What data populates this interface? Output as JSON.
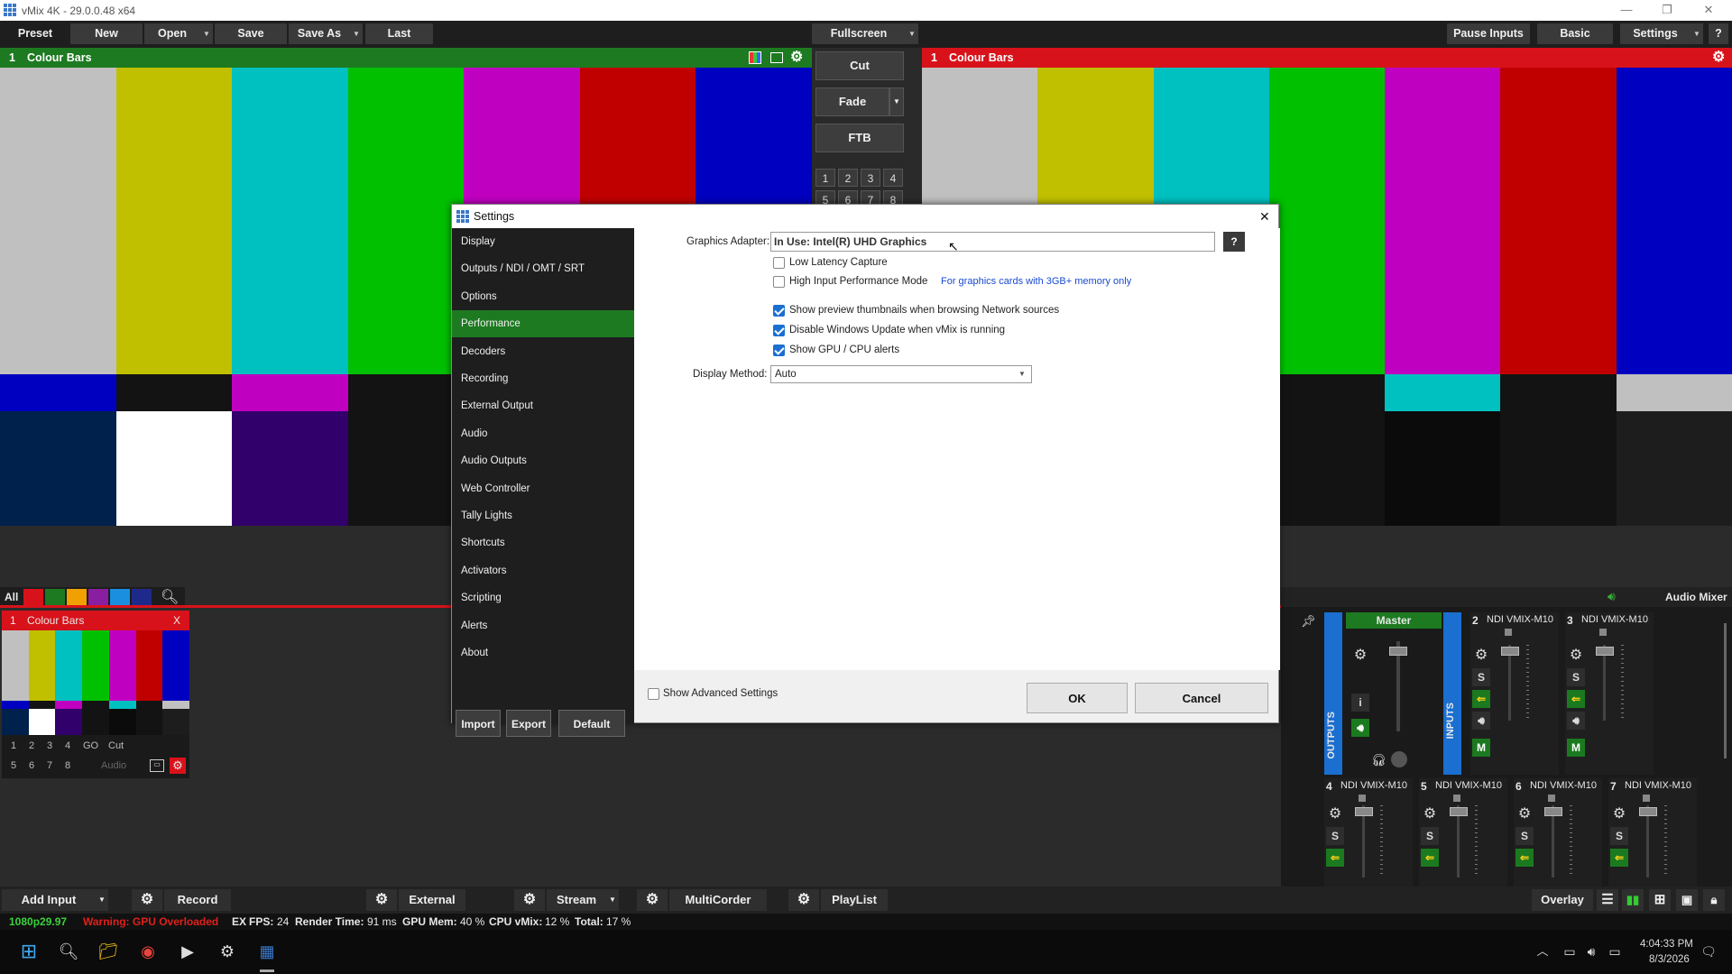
{
  "window": {
    "title": "vMix 4K - 29.0.0.48 x64"
  },
  "toolbar": {
    "preset": "Preset",
    "new": "New",
    "open": "Open",
    "save": "Save",
    "save_as": "Save As",
    "last": "Last",
    "fullscreen": "Fullscreen",
    "pause_inputs": "Pause Inputs",
    "basic": "Basic",
    "settings": "Settings",
    "help": "?"
  },
  "preview": {
    "number": "1",
    "name": "Colour Bars",
    "header_color": "#1d7a21"
  },
  "program": {
    "number": "1",
    "name": "Colour Bars",
    "header_color": "#d8121a"
  },
  "transitions": {
    "cut": "Cut",
    "fade": "Fade",
    "ftb": "FTB",
    "numbers": [
      "1",
      "2",
      "3",
      "4",
      "5",
      "6",
      "7",
      "8"
    ]
  },
  "colour_bars": {
    "top": [
      "#c0c0c0",
      "#c0c000",
      "#00c0c0",
      "#00c000",
      "#c000c0",
      "#c00000",
      "#0000c0"
    ],
    "mid": [
      "#0000c0",
      "#131313",
      "#c000c0",
      "#131313",
      "#00c0c0",
      "#131313",
      "#c0c0c0"
    ]
  },
  "filter": {
    "all": "All",
    "colors": [
      "#d8121a",
      "#1d7a21",
      "#f0a000",
      "#8a1ea0",
      "#1a8fe0",
      "#1e2a8a"
    ]
  },
  "input": {
    "number": "1",
    "name": "Colour Bars",
    "close": "X",
    "row1": [
      "1",
      "2",
      "3",
      "4",
      "GO",
      "Cut"
    ],
    "row2": [
      "5",
      "6",
      "7",
      "8"
    ],
    "audio": "Audio"
  },
  "dialog": {
    "title": "Settings",
    "close": "✕",
    "sidebar": [
      "Display",
      "Outputs / NDI / OMT / SRT",
      "Options",
      "Performance",
      "Decoders",
      "Recording",
      "External Output",
      "Audio",
      "Audio Outputs",
      "Web Controller",
      "Tally Lights",
      "Shortcuts",
      "Activators",
      "Scripting",
      "Alerts",
      "About"
    ],
    "active_item": "Performance",
    "graphics_adapter_label": "Graphics Adapter:",
    "graphics_adapter_value": "In Use: Intel(R) UHD Graphics",
    "help": "?",
    "low_latency": "Low Latency Capture",
    "high_input": "High Input Performance Mode",
    "high_input_note": "For graphics cards with 3GB+ memory only",
    "show_thumbnails": "Show preview thumbnails when browsing Network sources",
    "disable_update": "Disable Windows Update when vMix is running",
    "show_alerts": "Show GPU / CPU alerts",
    "display_method_label": "Display Method:",
    "display_method_value": "Auto",
    "import": "Import",
    "export": "Export",
    "default": "Default",
    "show_advanced": "Show Advanced Settings",
    "ok": "OK",
    "cancel": "Cancel"
  },
  "audio_mixer": {
    "title": "Audio Mixer",
    "outputs": "OUTPUTS",
    "inputs": "INPUTS",
    "master": "Master",
    "channels_top": [
      {
        "num": "2",
        "name": "NDI VMIX-M10"
      },
      {
        "num": "3",
        "name": "NDI VMIX-M10"
      }
    ],
    "channels_bottom": [
      {
        "num": "4",
        "name": "NDI VMIX-M10"
      },
      {
        "num": "5",
        "name": "NDI VMIX-M10"
      },
      {
        "num": "6",
        "name": "NDI VMIX-M10"
      },
      {
        "num": "7",
        "name": "NDI VMIX-M10"
      }
    ],
    "s": "S",
    "m": "M",
    "i": "i"
  },
  "bottom": {
    "add_input": "Add Input",
    "record": "Record",
    "external": "External",
    "stream": "Stream",
    "multicorder": "MultiCorder",
    "playlist": "PlayList",
    "overlay": "Overlay"
  },
  "status": {
    "format": "1080p29.97",
    "warning": "Warning: GPU Overloaded",
    "ex": "EX",
    "fps_label": "FPS:",
    "fps": "24",
    "render_label": "Render Time:",
    "render": "91 ms",
    "gpu_label": "GPU Mem:",
    "gpu": "40 %",
    "cpu_label": "CPU vMix:",
    "cpu": "12 %",
    "total_label": "Total:",
    "total": "17 %"
  },
  "taskbar": {
    "time": "4:04:33 PM",
    "date": "8/3/2026"
  }
}
